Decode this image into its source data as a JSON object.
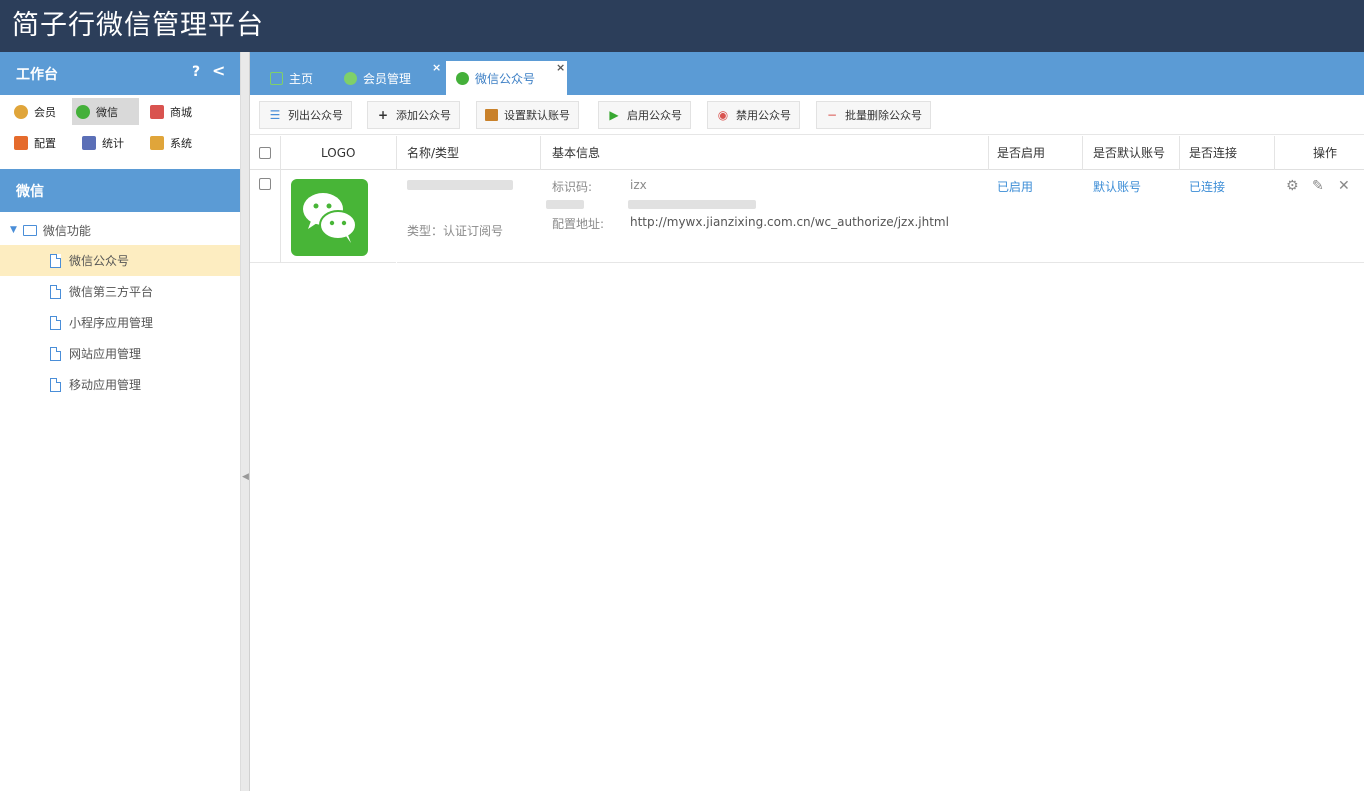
{
  "app": {
    "title": "简子行微信管理平台"
  },
  "sidebar": {
    "header": "工作台",
    "help_label": "?",
    "collapse_label": "<",
    "modules": [
      {
        "label": "会员",
        "icon": "member-icon",
        "color": "#e0a53a"
      },
      {
        "label": "微信",
        "icon": "wechat-icon",
        "color": "#44b03a"
      },
      {
        "label": "商城",
        "icon": "shop-icon",
        "color": "#d9534f"
      },
      {
        "label": "配置",
        "icon": "config-icon",
        "color": "#e56b2c"
      },
      {
        "label": "统计",
        "icon": "stats-icon",
        "color": "#5b6fb7"
      },
      {
        "label": "系统",
        "icon": "system-icon",
        "color": "#e0a53a"
      }
    ],
    "section_title": "微信",
    "tree": {
      "root": "微信功能",
      "items": [
        "微信公众号",
        "微信第三方平台",
        "小程序应用管理",
        "网站应用管理",
        "移动应用管理"
      ]
    }
  },
  "tabs": [
    {
      "label": "主页",
      "icon": "home-icon"
    },
    {
      "label": "会员管理",
      "icon": "user-icon"
    },
    {
      "label": "微信公众号",
      "icon": "users-icon"
    }
  ],
  "tab_close": "×",
  "toolbar": {
    "list": "列出公众号",
    "add": "添加公众号",
    "set_default": "设置默认账号",
    "enable": "启用公众号",
    "disable": "禁用公众号",
    "batch_delete": "批量删除公众号"
  },
  "grid": {
    "columns": {
      "logo": "LOGO",
      "name": "名称/类型",
      "info": "基本信息",
      "enabled": "是否启用",
      "default": "是否默认账号",
      "connected": "是否连接",
      "actions": "操作"
    },
    "rows": [
      {
        "type": "类型：认证订阅号",
        "id_label": "标识码:",
        "id_value": "izx",
        "url_label": "配置地址:",
        "url_value": "http://mywx.jianzixing.com.cn/wc_authorize/jzx.jhtml",
        "enabled": "已启用",
        "default": "默认账号",
        "connected": "已连接"
      }
    ]
  }
}
